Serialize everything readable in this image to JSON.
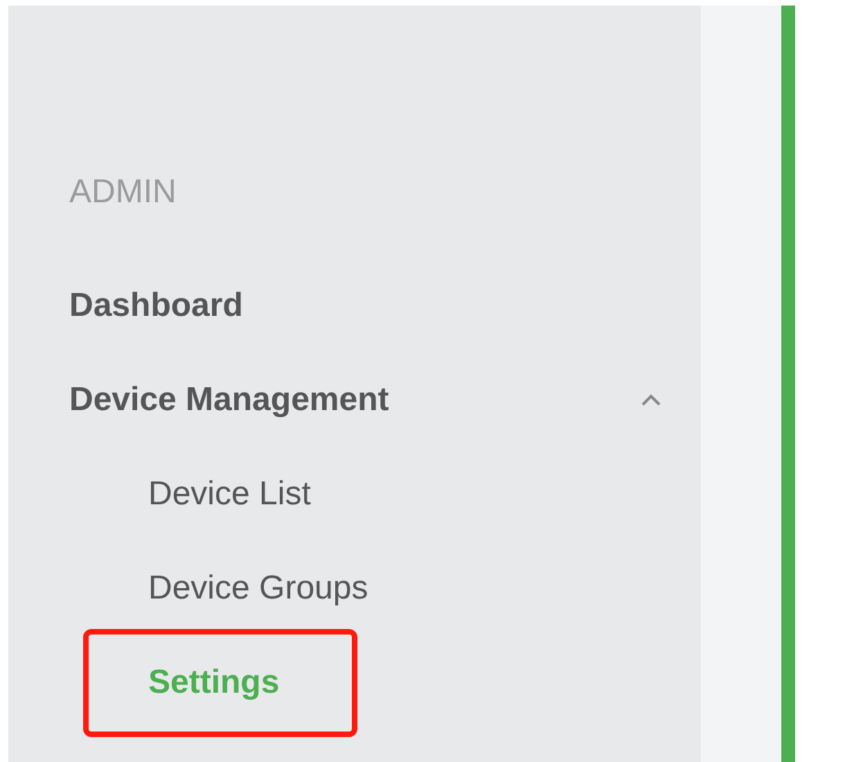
{
  "sidebar": {
    "section_label": "ADMIN",
    "items": [
      {
        "label": "Dashboard"
      },
      {
        "label": "Device Management",
        "expanded": true,
        "children": [
          {
            "label": "Device List",
            "selected": false,
            "highlighted": false
          },
          {
            "label": "Device Groups",
            "selected": false,
            "highlighted": false
          },
          {
            "label": "Settings",
            "selected": true,
            "highlighted": true
          }
        ]
      }
    ]
  }
}
